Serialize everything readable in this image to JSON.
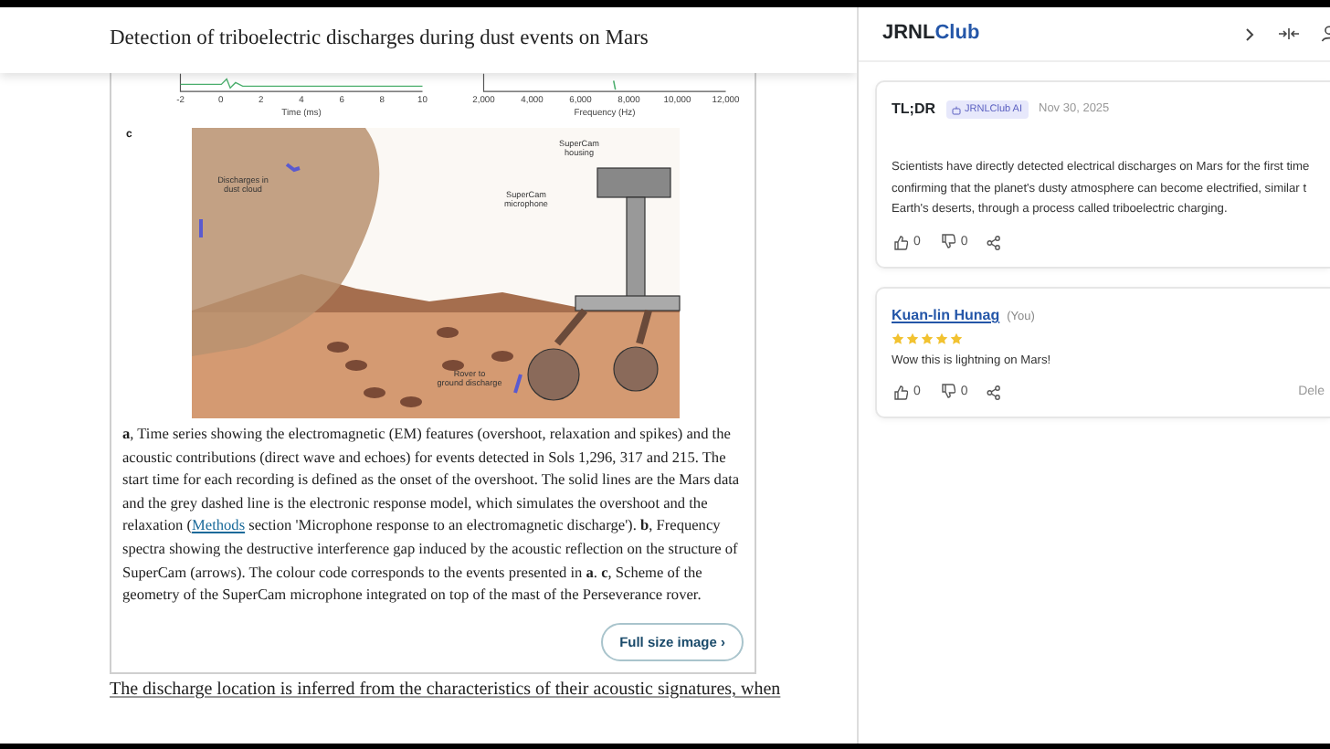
{
  "article": {
    "title": "Detection of triboelectric discharges during dust events on Mars",
    "figure": {
      "panel_a_axis": {
        "ticks": [
          "-2",
          "0",
          "2",
          "4",
          "6",
          "8",
          "10"
        ],
        "label": "Time (ms)"
      },
      "panel_b_axis": {
        "ticks": [
          "2,000",
          "4,000",
          "6,000",
          "8,000",
          "10,000",
          "12,000"
        ],
        "label": "Frequency (Hz)"
      },
      "panel_c": {
        "letter": "c",
        "labels": [
          {
            "kind": "dust",
            "text": "Discharges in dust cloud"
          },
          {
            "kind": "housing",
            "text": "SuperCam housing"
          },
          {
            "kind": "microphone",
            "text": "SuperCam microphone"
          },
          {
            "kind": "ground",
            "text": "Rover to ground discharge"
          }
        ]
      },
      "caption": [
        {
          "kind": "text",
          "text": "**a**, Time series showing the electromagnetic (EM) features (overshoot, relaxation and spikes) and the acoustic contributions (direct wave and echoes) for events detected in Sols 1,296, 317 and 215. The start time for each recording is defined as the onset of the overshoot. The solid lines are the Mars data and the grey dashed line is the electronic response model, which simulates the overshoot and the relaxation ("
        },
        {
          "kind": "link",
          "text": "Methods"
        },
        {
          "kind": "text",
          "text": " section 'Microphone response to an electromagnetic discharge'). **b**, Frequency spectra showing the destructive interference gap induced by the acoustic reflection on the structure of SuperCam (arrows). The colour code corresponds to the events presented in **a**. **c**, Scheme of the geometry of the SuperCam microphone integrated on top of the mast of the Perseverance rover."
        }
      ],
      "full_size_button": "Full size image ›"
    },
    "paragraph": "The discharge location is inferred from the characteristics of their acoustic signatures, when"
  },
  "sidebar": {
    "logo": {
      "part_1": "JRNL",
      "part_2": "Club"
    },
    "cards": [
      {
        "kind": "summary",
        "title": "TL;DR",
        "badge": "JRNLClub AI",
        "date": "Nov 30, 2025",
        "body_lines": [
          "Scientists have directly detected electrical discharges on Mars for the first time",
          "confirming that the planet's dusty atmosphere can become electrified, similar t",
          "Earth's deserts, through a process called triboelectric charging."
        ],
        "likes": "0",
        "dislikes": "0"
      },
      {
        "kind": "comment",
        "author": "Kuan-lin Hunag",
        "author_note": "(You)",
        "stars": 5,
        "body_lines": [
          "Wow this is lightning on Mars!"
        ],
        "likes": "0",
        "dislikes": "0",
        "action": "Dele"
      }
    ]
  }
}
